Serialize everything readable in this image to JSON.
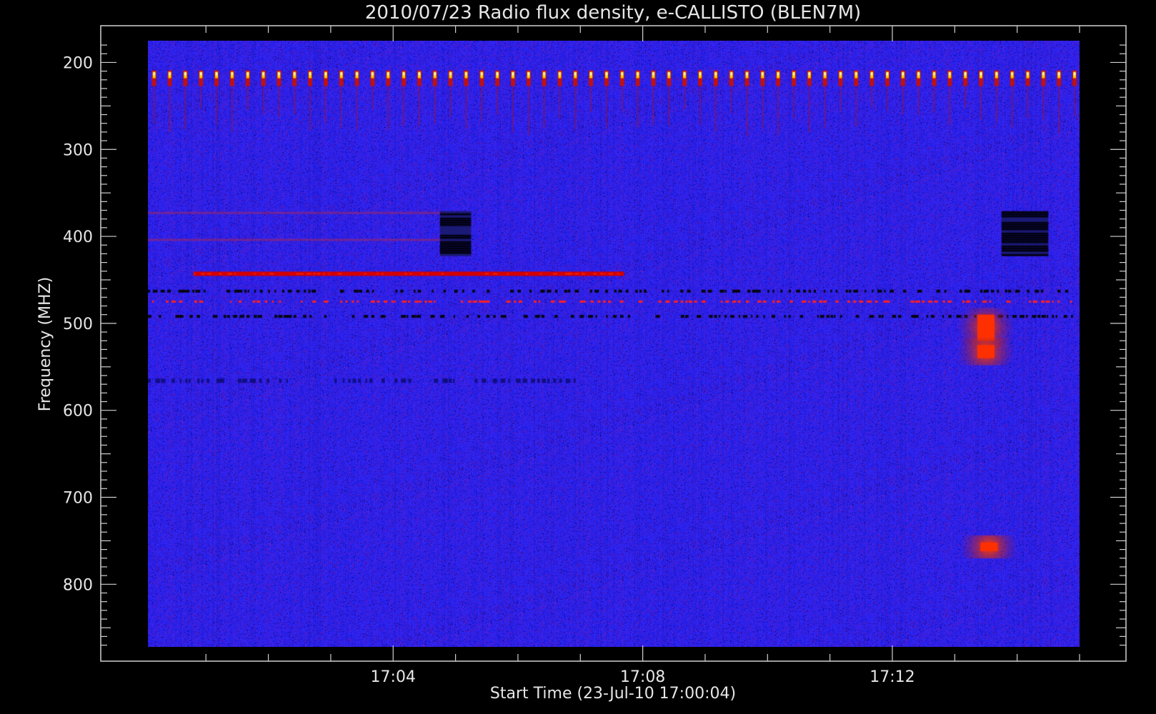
{
  "chart_data": {
    "type": "heatmap",
    "title": "2010/07/23  Radio flux density, e-CALLISTO (BLEN7M)",
    "xlabel": "Start Time (23-Jul-10 17:00:04)",
    "ylabel": "Frequency (MHZ)",
    "x_ticks": [
      "17:04",
      "17:08",
      "17:12"
    ],
    "x_tick_minutes": [
      4,
      8,
      12
    ],
    "y_ticks": [
      200,
      300,
      400,
      500,
      600,
      700,
      800
    ],
    "xlim_minutes": [
      0.07,
      15.0
    ],
    "ylim_mhz": [
      175,
      872
    ],
    "y_reversed": true,
    "colormap": [
      "#000000",
      "#0000ff",
      "#ff0000",
      "#ffff00",
      "#ffffff"
    ],
    "background_color": "#2a2af0",
    "features": [
      {
        "kind": "periodic-interference-spikes",
        "freq_mhz": 214,
        "start_min": 0.07,
        "end_min": 15.0,
        "period_min": 0.25
      },
      {
        "kind": "persistent-red-line",
        "freq_mhz": 443,
        "start_min": 0.8,
        "end_min": 7.7
      },
      {
        "kind": "black-line",
        "freq_mhz": 463,
        "start_min": 0.07,
        "end_min": 15.0
      },
      {
        "kind": "dashed-red-line",
        "freq_mhz": 475,
        "start_min": 0.07,
        "end_min": 15.0
      },
      {
        "kind": "black-line",
        "freq_mhz": 492,
        "start_min": 0.07,
        "end_min": 15.0
      },
      {
        "kind": "faint-red-line",
        "freq_mhz": 373,
        "start_min": 0.07,
        "end_min": 5.0
      },
      {
        "kind": "faint-red-line",
        "freq_mhz": 404,
        "start_min": 0.07,
        "end_min": 5.0
      },
      {
        "kind": "dark-blue-band",
        "freq_mhz": 566,
        "start_min": 0.07,
        "end_min": 7.0
      },
      {
        "kind": "calibration-gap",
        "freq_start_mhz": 371,
        "freq_end_mhz": 422,
        "start_min": 4.75,
        "end_min": 5.25
      },
      {
        "kind": "calibration-gap",
        "freq_start_mhz": 371,
        "freq_end_mhz": 422,
        "start_min": 13.75,
        "end_min": 14.5
      },
      {
        "kind": "burst",
        "freq_start_mhz": 490,
        "freq_end_mhz": 520,
        "time_min": 13.5
      },
      {
        "kind": "burst",
        "freq_start_mhz": 525,
        "freq_end_mhz": 540,
        "time_min": 13.5
      },
      {
        "kind": "burst",
        "freq_start_mhz": 752,
        "freq_end_mhz": 762,
        "time_min": 13.55
      }
    ]
  }
}
